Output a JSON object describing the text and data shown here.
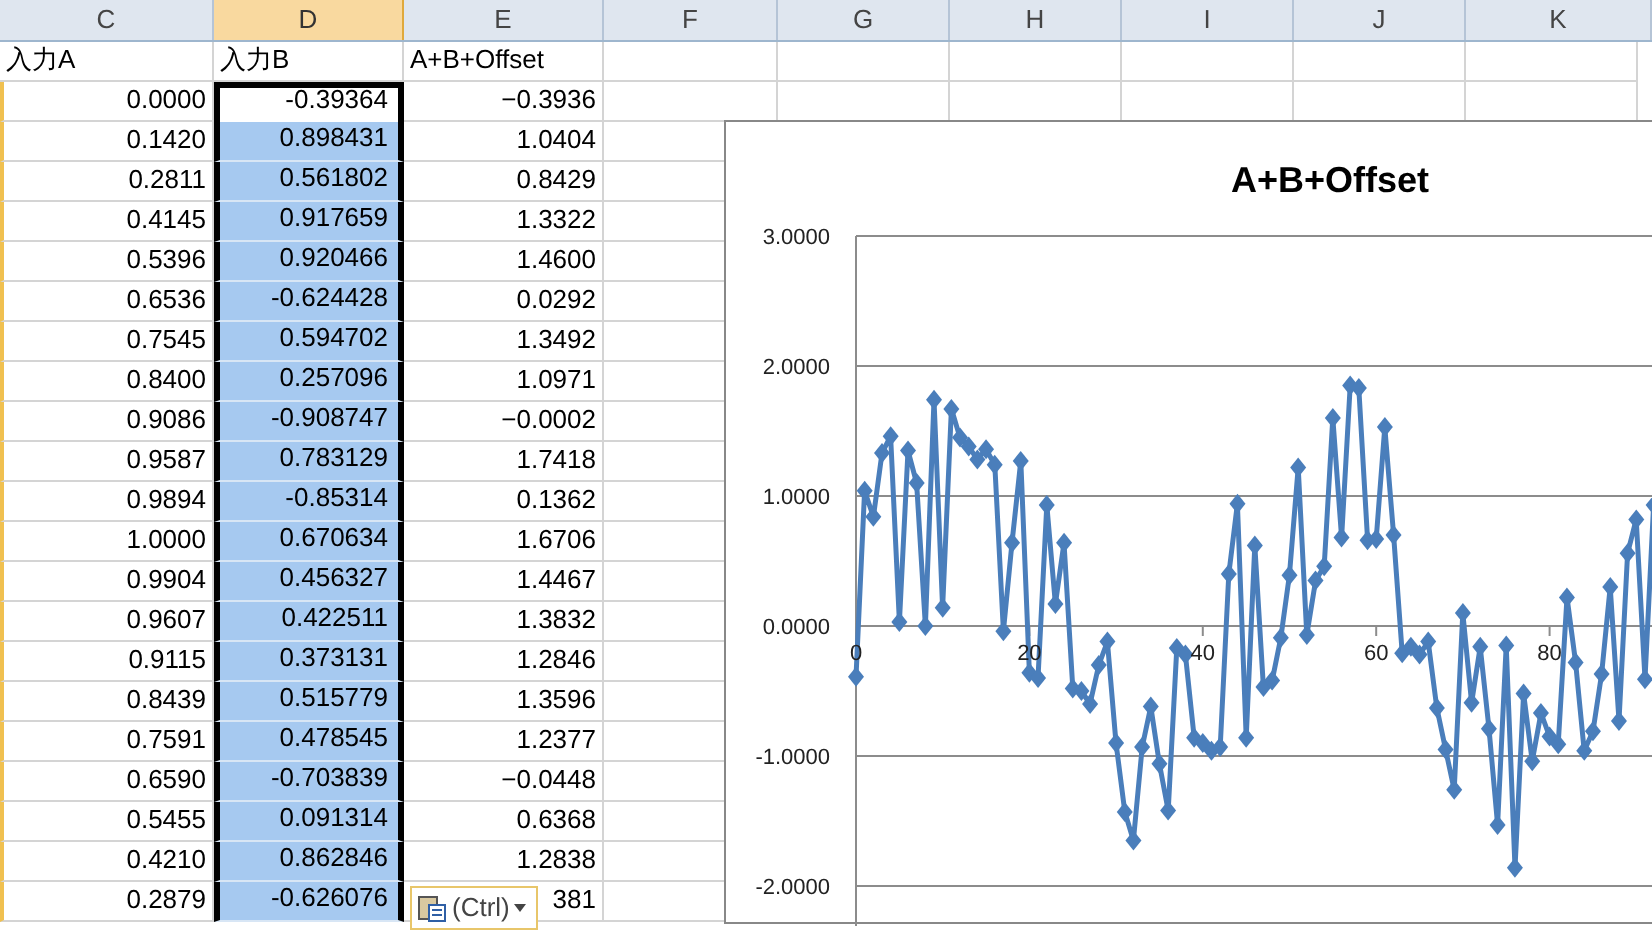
{
  "columns": [
    {
      "label": "C",
      "selected": false
    },
    {
      "label": "D",
      "selected": true
    },
    {
      "label": "E",
      "selected": false
    },
    {
      "label": "F",
      "selected": false
    },
    {
      "label": "G",
      "selected": false
    },
    {
      "label": "H",
      "selected": false
    },
    {
      "label": "I",
      "selected": false
    },
    {
      "label": "J",
      "selected": false
    },
    {
      "label": "K",
      "selected": false
    }
  ],
  "header_row": [
    "入力A",
    "入力B",
    "A+B+Offset"
  ],
  "rows": [
    {
      "input_a": "0.0000",
      "input_b": "-0.39364",
      "sum": "−0.3936",
      "selected": false
    },
    {
      "input_a": "0.1420",
      "input_b": "0.898431",
      "sum": "1.0404",
      "selected": true
    },
    {
      "input_a": "0.2811",
      "input_b": "0.561802",
      "sum": "0.8429",
      "selected": true
    },
    {
      "input_a": "0.4145",
      "input_b": "0.917659",
      "sum": "1.3322",
      "selected": true
    },
    {
      "input_a": "0.5396",
      "input_b": "0.920466",
      "sum": "1.4600",
      "selected": true
    },
    {
      "input_a": "0.6536",
      "input_b": "-0.624428",
      "sum": "0.0292",
      "selected": true
    },
    {
      "input_a": "0.7545",
      "input_b": "0.594702",
      "sum": "1.3492",
      "selected": true
    },
    {
      "input_a": "0.8400",
      "input_b": "0.257096",
      "sum": "1.0971",
      "selected": true
    },
    {
      "input_a": "0.9086",
      "input_b": "-0.908747",
      "sum": "−0.0002",
      "selected": true
    },
    {
      "input_a": "0.9587",
      "input_b": "0.783129",
      "sum": "1.7418",
      "selected": true
    },
    {
      "input_a": "0.9894",
      "input_b": "-0.85314",
      "sum": "0.1362",
      "selected": true
    },
    {
      "input_a": "1.0000",
      "input_b": "0.670634",
      "sum": "1.6706",
      "selected": true
    },
    {
      "input_a": "0.9904",
      "input_b": "0.456327",
      "sum": "1.4467",
      "selected": true
    },
    {
      "input_a": "0.9607",
      "input_b": "0.422511",
      "sum": "1.3832",
      "selected": true
    },
    {
      "input_a": "0.9115",
      "input_b": "0.373131",
      "sum": "1.2846",
      "selected": true
    },
    {
      "input_a": "0.8439",
      "input_b": "0.515779",
      "sum": "1.3596",
      "selected": true
    },
    {
      "input_a": "0.7591",
      "input_b": "0.478545",
      "sum": "1.2377",
      "selected": true
    },
    {
      "input_a": "0.6590",
      "input_b": "-0.703839",
      "sum": "−0.0448",
      "selected": true
    },
    {
      "input_a": "0.5455",
      "input_b": "0.091314",
      "sum": "0.6368",
      "selected": true
    },
    {
      "input_a": "0.4210",
      "input_b": "0.862846",
      "sum": "1.2838",
      "selected": true
    },
    {
      "input_a": "0.2879",
      "input_b": "-0.626076",
      "sum": "381",
      "selected": true
    }
  ],
  "paste_options": {
    "label": "(Ctrl)"
  },
  "chart": {
    "chart_data": {
      "type": "line",
      "title": "A+B+Offset",
      "xlim": [
        0,
        124.8
      ],
      "ylim": [
        -2.31,
        3
      ],
      "grid": true,
      "xticks": [
        0,
        20,
        40,
        60,
        80
      ],
      "yticks": [
        {
          "value": -2,
          "label": "-2.0000"
        },
        {
          "value": -1,
          "label": "-1.0000"
        },
        {
          "value": 0,
          "label": "0.0000"
        },
        {
          "value": 1,
          "label": "1.0000"
        },
        {
          "value": 2,
          "label": "2.0000"
        },
        {
          "value": 3,
          "label": "3.0000"
        }
      ],
      "x": [
        0,
        1,
        2,
        3,
        4,
        5,
        6,
        7,
        8,
        9,
        10,
        11,
        12,
        13,
        14,
        15,
        16,
        17,
        18,
        19,
        20,
        21,
        22,
        23,
        24,
        25,
        26,
        27,
        28,
        29,
        30,
        31,
        32,
        33,
        34,
        35,
        36,
        37,
        38,
        39,
        40,
        41,
        42,
        43,
        44,
        45,
        46,
        47,
        48,
        49,
        50,
        51,
        52,
        53,
        54,
        55,
        56,
        57,
        58,
        59,
        60,
        61,
        62,
        63,
        64,
        65,
        66,
        67,
        68,
        69,
        70,
        71,
        72,
        73,
        74,
        75,
        76,
        77,
        78,
        79,
        80,
        81,
        82,
        83,
        84,
        85,
        86,
        87,
        88,
        89,
        90,
        91,
        92
      ],
      "series": [
        {
          "color": "#4a7ebb",
          "marker": "diamond",
          "values": [
            -0.39,
            1.04,
            0.84,
            1.33,
            1.46,
            0.03,
            1.35,
            1.1,
            0.0,
            1.74,
            0.14,
            1.67,
            1.45,
            1.38,
            1.28,
            1.36,
            1.24,
            -0.04,
            0.64,
            1.27,
            -0.36,
            -0.4,
            0.93,
            0.17,
            0.64,
            -0.48,
            -0.5,
            -0.6,
            -0.3,
            -0.12,
            -0.9,
            -1.43,
            -1.65,
            -0.93,
            -0.62,
            -1.06,
            -1.42,
            -0.17,
            -0.22,
            -0.86,
            -0.9,
            -0.96,
            -0.93,
            0.4,
            0.94,
            -0.86,
            0.62,
            -0.47,
            -0.42,
            -0.09,
            0.39,
            1.22,
            -0.07,
            0.35,
            0.46,
            1.6,
            0.68,
            1.85,
            1.83,
            0.66,
            0.67,
            1.53,
            0.7,
            -0.21,
            -0.16,
            -0.22,
            -0.12,
            -0.63,
            -0.95,
            -1.26,
            0.1,
            -0.59,
            -0.16,
            -0.79,
            -1.53,
            -0.15,
            -1.86,
            -0.52,
            -1.04,
            -0.67,
            -0.85,
            -0.91,
            0.22,
            -0.28,
            -0.96,
            -0.81,
            -0.37,
            0.3,
            -0.73,
            0.56,
            0.82,
            -0.41,
            0.93
          ]
        }
      ]
    }
  }
}
